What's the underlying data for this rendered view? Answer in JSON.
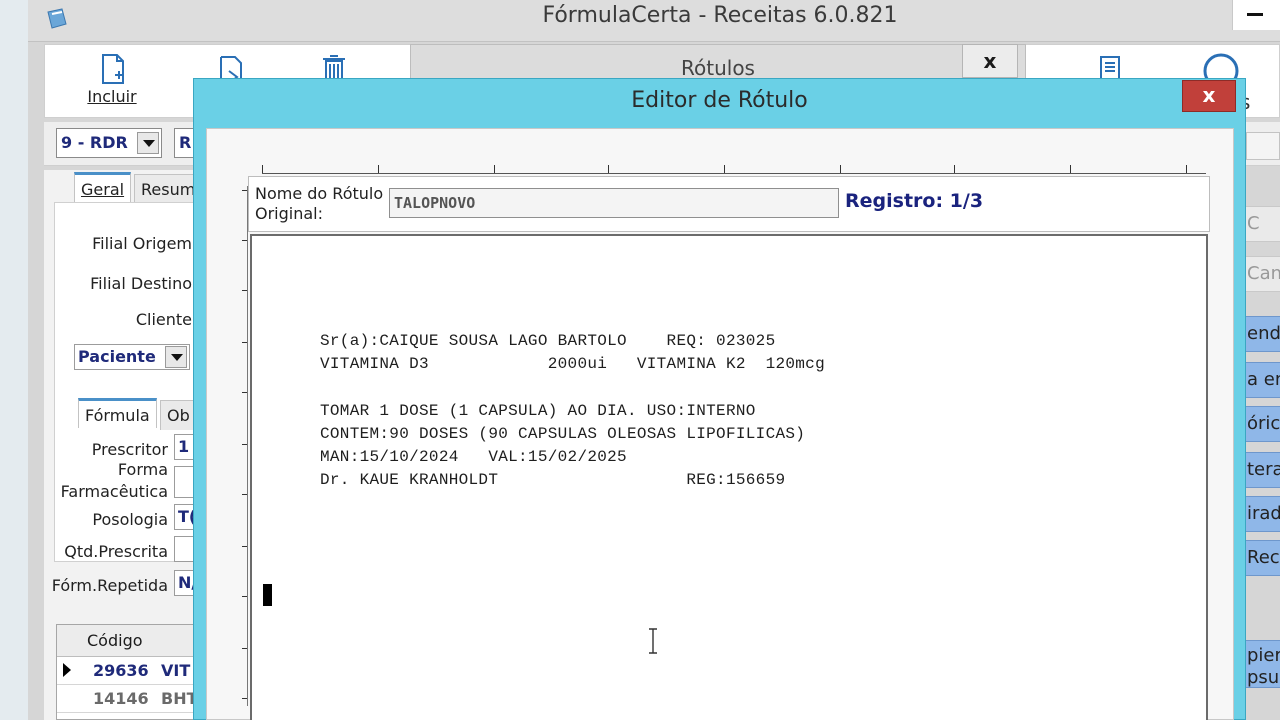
{
  "app": {
    "title": "FórmulaCerta - Receitas 6.0.821"
  },
  "toolbar": {
    "incluir": "Incluir"
  },
  "subbar": {
    "combo_value": "9 - RDR",
    "combo2_value": "R"
  },
  "left_tabs": {
    "geral": "Geral",
    "resumo": "Resum"
  },
  "left_fields": {
    "filial_origem": "Filial Origem",
    "filial_destino": "Filial Destino",
    "cliente": "Cliente",
    "paciente": "Paciente"
  },
  "formula_tabs": {
    "formula": "Fórmula",
    "obs": "Ob"
  },
  "formula_fields": {
    "prescritor": "Prescritor",
    "prescritor_value": "1",
    "forma": "Forma",
    "farmaceutica": "Farmacêutica",
    "posologia": "Posologia",
    "posologia_value": "T(",
    "qtd_prescrita": "Qtd.Prescrita",
    "form_repetida": "Fórm.Repetida",
    "form_repetida_value": "N/"
  },
  "grid": {
    "header": "Código",
    "rows": [
      {
        "code": "29636",
        "desc": "VIT"
      },
      {
        "code": "14146",
        "desc": "BHT"
      }
    ]
  },
  "rotulos": {
    "title": "Rótulos",
    "close": "x"
  },
  "right_buttons": [
    "C",
    "Can",
    "enda",
    "a en",
    "óric",
    "terar",
    "irada",
    "Recá",
    "pier"
  ],
  "right_bottom": "psu",
  "right_top_label": "s",
  "dialog": {
    "title": "Editor de Rótulo",
    "close": "x",
    "name_label_line1": "Nome do Rótulo",
    "name_label_line2": "Original:",
    "name_value": "TALOPNOVO",
    "registro": "Registro: 1/3"
  },
  "label_text": {
    "line1": "Sr(a):CAIQUE SOUSA LAGO BARTOLO    REQ: 023025",
    "line2": "VITAMINA D3            2000ui   VITAMINA K2  120mcg",
    "line3": "TOMAR 1 DOSE (1 CAPSULA) AO DIA. USO:INTERNO",
    "line4": "CONTEM:90 DOSES (90 CAPSULAS OLEOSAS LIPOFILICAS)",
    "line5": "MAN:15/10/2024   VAL:15/02/2025",
    "line6": "Dr. KAUE KRANHOLDT                   REG:156659"
  }
}
